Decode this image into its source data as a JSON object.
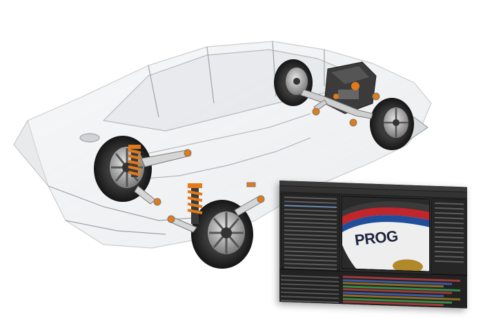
{
  "scene": {
    "description_free": true,
    "background": "#ffffff",
    "accent": "#e07a1a",
    "car_body_color": "#c9ccd0",
    "tire_color": "#1e1e1e",
    "spring_color": "#e07a1a"
  },
  "editor": {
    "ui_color": "#2b2b2b",
    "viewer_brand_text": "PROG",
    "timeline_colors": [
      "#a03a3a",
      "#3a5aa0",
      "#8a6b2a",
      "#3a8a4a"
    ]
  }
}
